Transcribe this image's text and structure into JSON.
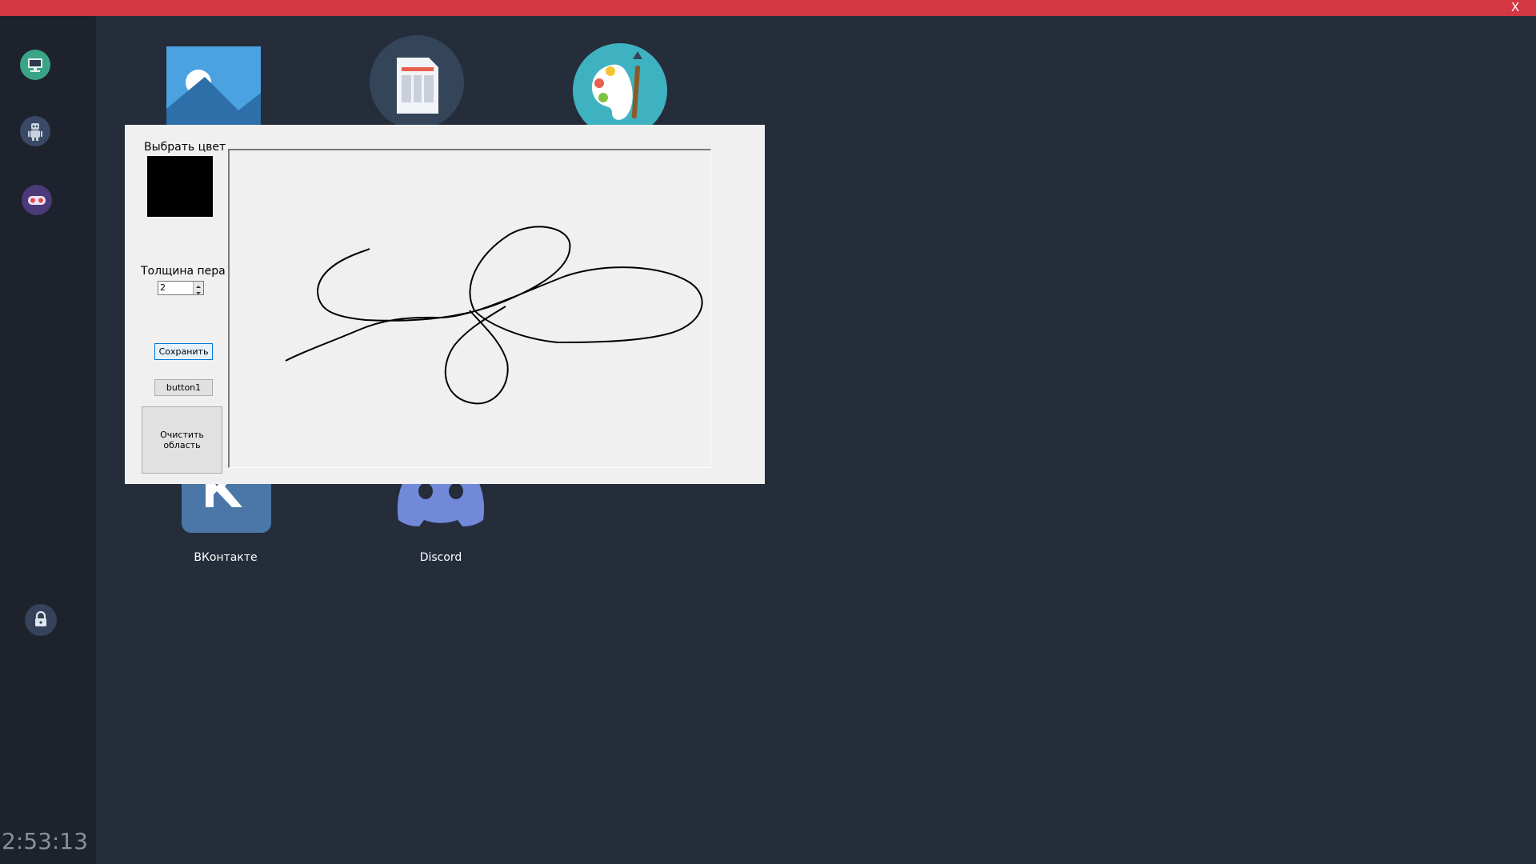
{
  "titlebar": {
    "close_label": "X",
    "accent": "#d23742"
  },
  "sidebar": {
    "icons": [
      "monitor-icon",
      "robot-icon",
      "gamepad-icon"
    ],
    "lock_icon": "lock-icon",
    "clock": "2:53:13"
  },
  "desktop": {
    "apps": [
      {
        "name": "photos-app",
        "icon": "photo-icon",
        "label": ""
      },
      {
        "name": "document-app",
        "icon": "document-icon",
        "label": ""
      },
      {
        "name": "paint-app",
        "icon": "palette-icon",
        "label": ""
      },
      {
        "name": "vk-app",
        "icon": "vk-icon",
        "label": "ВКонтакте"
      },
      {
        "name": "discord-app",
        "icon": "discord-icon",
        "label": "Discord"
      }
    ]
  },
  "paint": {
    "choose_color_label": "Выбрать цвет",
    "selected_color": "#000000",
    "pen_width_label": "Толщина пера",
    "pen_width_value": "2",
    "save_label": "Сохранить",
    "button1_label": "button1",
    "clear_label": "Очистить область"
  }
}
